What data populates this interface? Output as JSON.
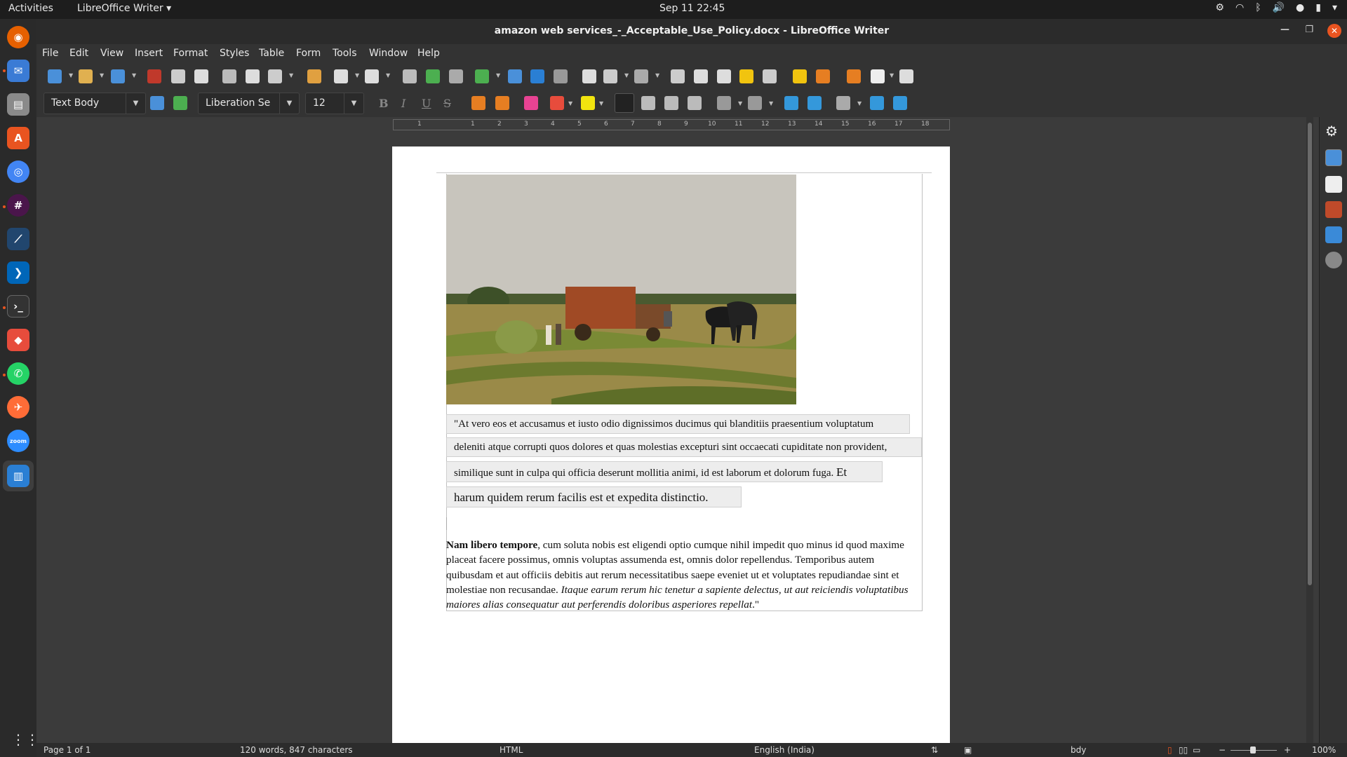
{
  "topbar": {
    "activities": "Activities",
    "app_menu": "LibreOffice Writer ▾",
    "clock": "Sep 11  22:45"
  },
  "window": {
    "title": "amazon web services_-_Acceptable_Use_Policy.docx - LibreOffice Writer"
  },
  "menubar": [
    "File",
    "Edit",
    "View",
    "Insert",
    "Format",
    "Styles",
    "Table",
    "Form",
    "Tools",
    "Window",
    "Help"
  ],
  "formatting": {
    "paragraph_style": "Text Body",
    "font_name": "Liberation Se",
    "font_size": "12",
    "bold": "B",
    "italic": "I",
    "underline": "U",
    "strike": "S"
  },
  "ruler": {
    "numbers": [
      "1",
      "1",
      "2",
      "3",
      "4",
      "5",
      "6",
      "7",
      "8",
      "9",
      "10",
      "11",
      "12",
      "13",
      "14",
      "15",
      "16",
      "17",
      "18"
    ]
  },
  "document": {
    "quote_lines": [
      "\"At vero eos et accusamus et iusto odio dignissimos ducimus qui blanditiis praesentium voluptatum",
      "deleniti atque corrupti quos dolores et quas molestias excepturi sint occaecati cupiditate non provident,",
      "similique sunt in culpa qui officia deserunt mollitia animi, id est laborum et dolorum fuga.",
      "Et",
      "harum quidem rerum facilis est et expedita distinctio."
    ],
    "para_bold": "Nam libero tempore",
    "para_text": ", cum soluta nobis est eligendi optio cumque nihil impedit quo minus id quod maxime placeat facere possimus, omnis voluptas assumenda est, omnis dolor repellendus. Temporibus autem quibusdam et aut officiis debitis aut rerum necessitatibus saepe eveniet ut et voluptates repudiandae sint et molestiae non recusandae. ",
    "para_italic": "Itaque earum rerum hic tenetur a sapiente delectus, ut aut reiciendis voluptatibus maiores alias consequatur aut perferendis doloribus asperiores repellat",
    "para_end": ".\""
  },
  "statusbar": {
    "page": "Page 1 of 1",
    "counts": "120 words, 847 characters",
    "mode": "HTML",
    "language": "English (India)",
    "style": "bdy",
    "zoom": "100%"
  },
  "colors": {
    "accent": "#e95420",
    "toolbar_bg": "#333333",
    "page_bg": "#ffffff"
  }
}
